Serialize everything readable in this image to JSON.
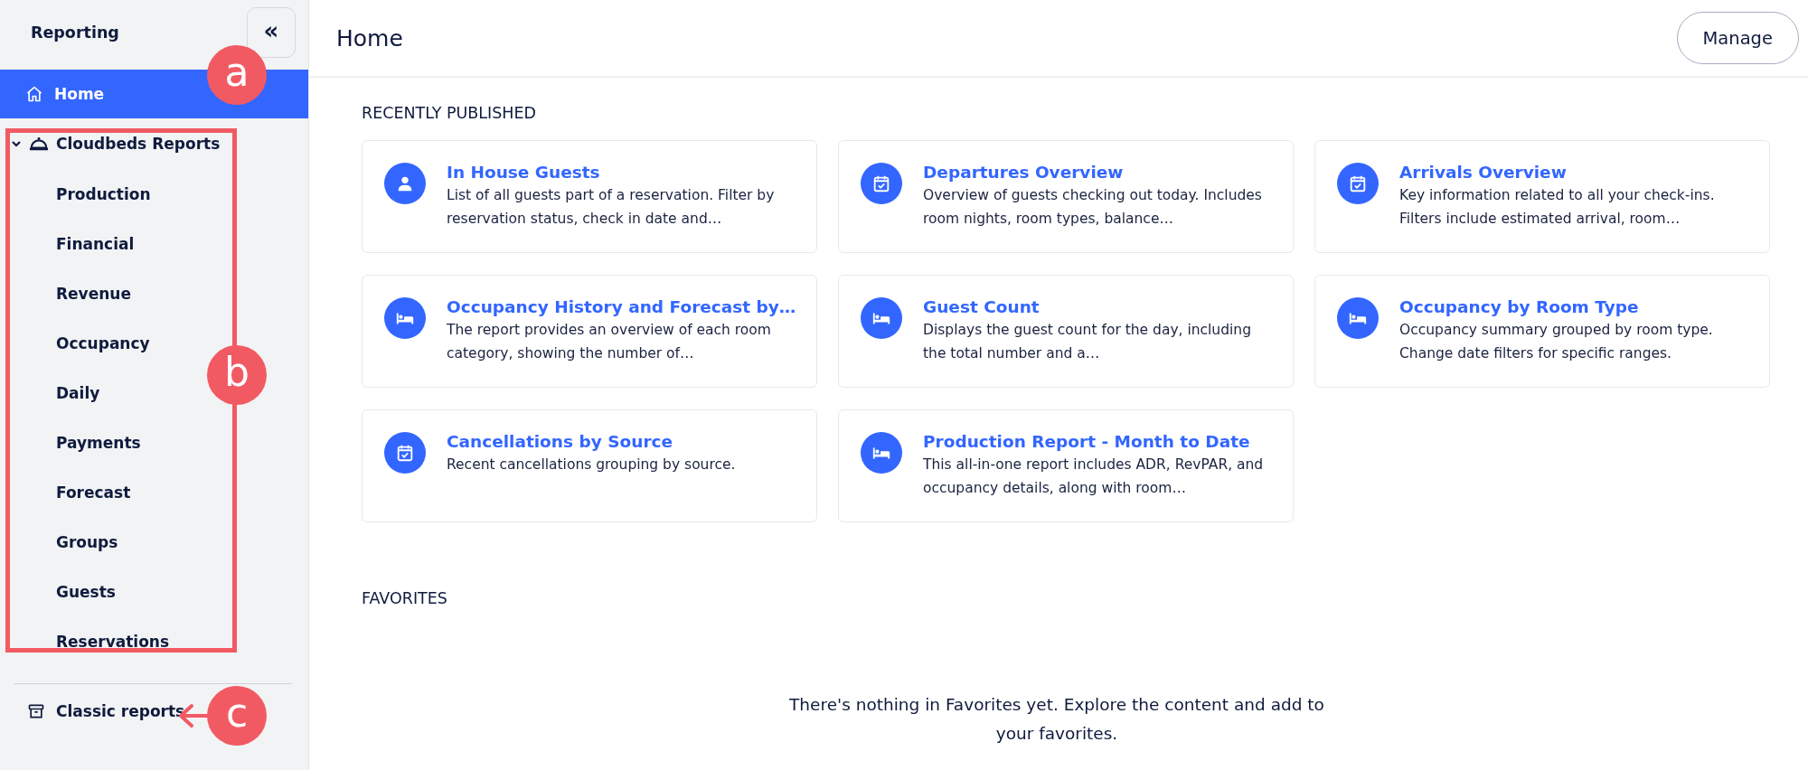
{
  "sidebar": {
    "title": "Reporting",
    "collapse_button": "«",
    "items": [
      {
        "label": "Home",
        "kind": "home",
        "selected": true
      },
      {
        "label": "Cloudbeds Reports",
        "kind": "cloche",
        "expanded": true,
        "children": [
          {
            "label": "Production",
            "selected": false
          },
          {
            "label": "Financial",
            "selected": false
          },
          {
            "label": "Revenue",
            "selected": false
          },
          {
            "label": "Occupancy",
            "selected": false
          },
          {
            "label": "Daily",
            "selected": false
          },
          {
            "label": "Payments",
            "selected": false
          },
          {
            "label": "Forecast",
            "selected": false
          },
          {
            "label": "Groups",
            "selected": false
          },
          {
            "label": "Guests",
            "selected": false
          },
          {
            "label": "Reservations",
            "selected": false
          }
        ]
      }
    ],
    "footer_item": {
      "label": "Classic reports",
      "kind": "archive"
    }
  },
  "header": {
    "title": "Home",
    "button": "Manage"
  },
  "recently_published": {
    "heading": "RECENTLY PUBLISHED",
    "cards": [
      {
        "kind": "person",
        "title": "In House Guests",
        "description": "List of all guests part of a reservation. Filter by reservation status, check in date and…"
      },
      {
        "kind": "calendar",
        "title": "Departures Overview",
        "description": "Overview of guests checking out today. Includes room nights, room types, balance…"
      },
      {
        "kind": "calendar",
        "title": "Arrivals Overview",
        "description": "Key information related to all your check-ins. Filters include estimated arrival, room…"
      },
      {
        "kind": "bed",
        "title": "Occupancy History and Forecast by…",
        "description": "The report provides an overview of each room category, showing the number of…"
      },
      {
        "kind": "bed",
        "title": "Guest Count",
        "description": "Displays the guest count for the day, including the total number and a…"
      },
      {
        "kind": "bed",
        "title": "Occupancy by Room Type",
        "description": "Occupancy summary grouped by room type. Change date filters for specific ranges."
      },
      {
        "kind": "calendar",
        "title": "Cancellations by Source",
        "description": "Recent cancellations grouping by source."
      },
      {
        "kind": "bed",
        "title": "Production Report - Month to Date",
        "description": "This all-in-one report includes ADR, RevPAR, and occupancy details, along with room…"
      }
    ]
  },
  "favorites": {
    "heading": "FAVORITES",
    "empty_message": "There's nothing in Favorites yet. Explore the content and add to your favorites."
  },
  "annotations": [
    {
      "kind": "marker",
      "label": "a"
    },
    {
      "kind": "frame",
      "label": "b"
    },
    {
      "kind": "arrow",
      "label": "c"
    }
  ]
}
